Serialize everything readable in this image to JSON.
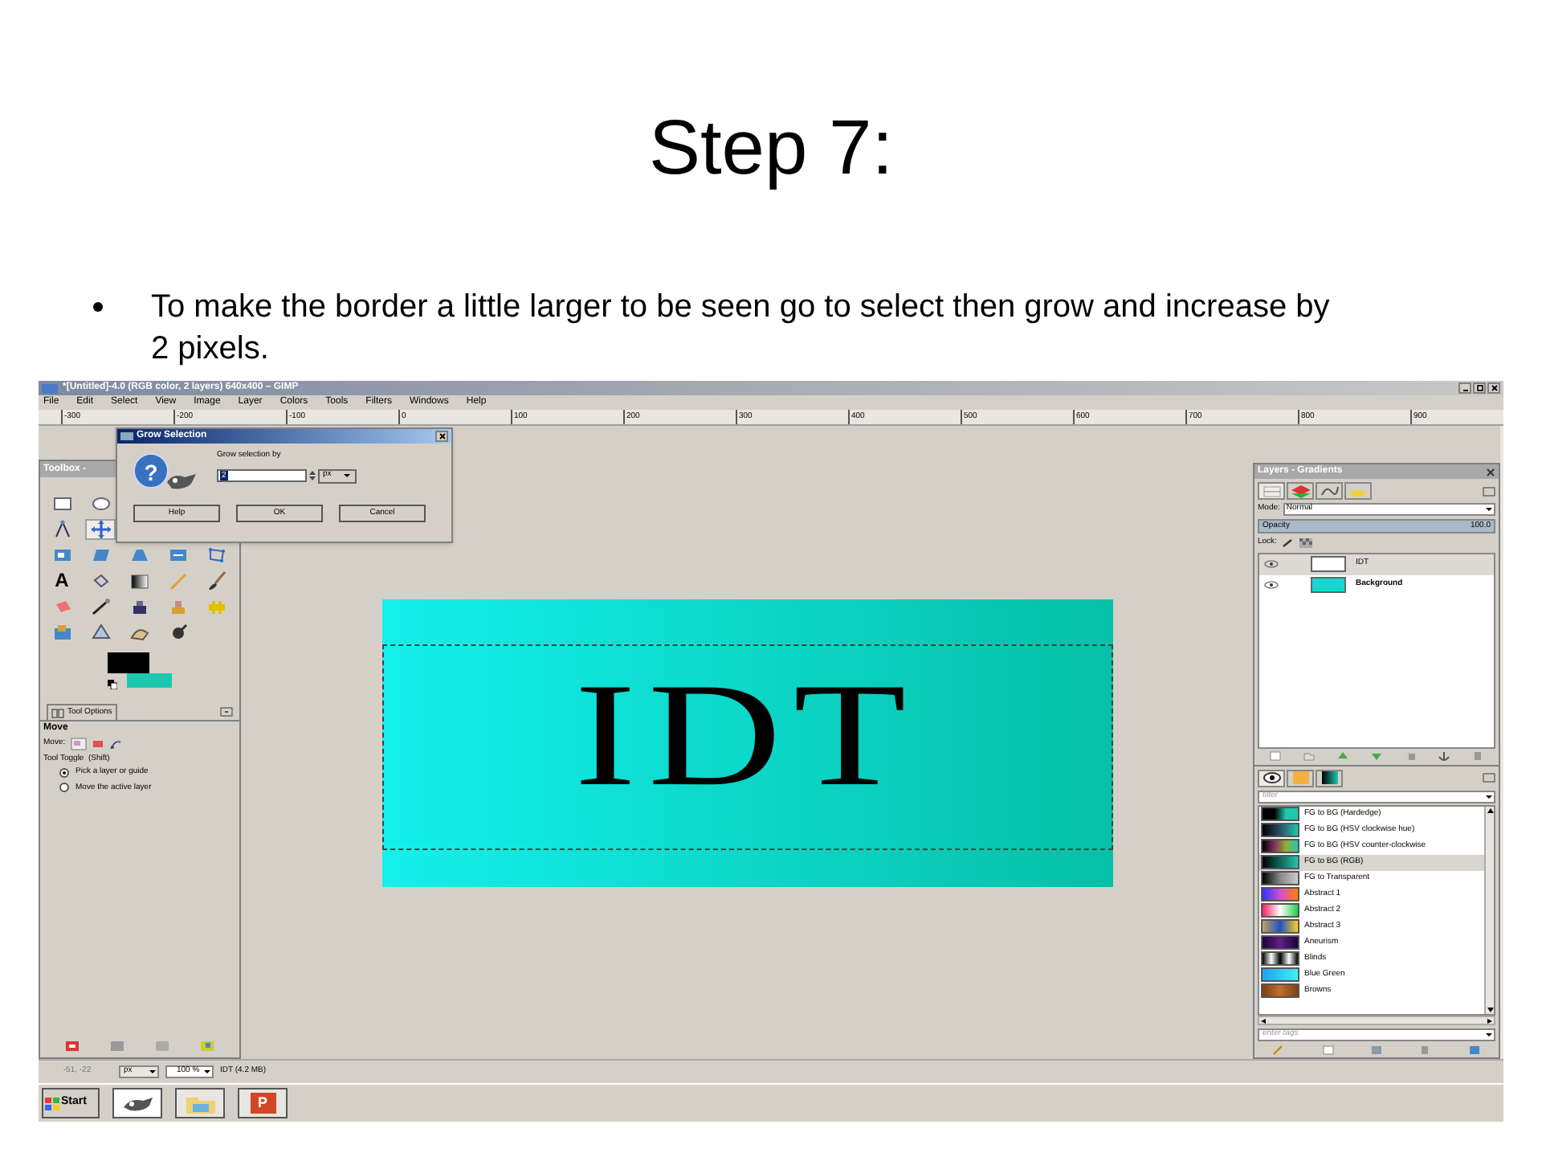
{
  "slide": {
    "title": "Step 7:",
    "bullets": [
      "To make the border a little larger to be seen go to select then grow and increase by 2 pixels."
    ]
  },
  "window": {
    "title": "*[Untitled]-4.0 (RGB color, 2 layers) 640x400 – GIMP",
    "menu": [
      "File",
      "Edit",
      "Select",
      "View",
      "Image",
      "Layer",
      "Colors",
      "Tools",
      "Filters",
      "Windows",
      "Help"
    ],
    "ruler_ticks": [
      "-300",
      "-200",
      "-100",
      "0",
      "100",
      "200",
      "300",
      "400",
      "500",
      "600",
      "700",
      "800",
      "900"
    ]
  },
  "toolbox": {
    "title": "Toolbox - ",
    "text_tool_glyph": "A",
    "options_tab": "Tool Options",
    "tool_name": "Move",
    "move_label": "Move:",
    "toggle_label": "Tool Toggle  (Shift)",
    "radios": [
      {
        "label": "Pick a layer or guide",
        "selected": true
      },
      {
        "label": "Move the active layer",
        "selected": false
      }
    ]
  },
  "canvas": {
    "text": "IDT"
  },
  "dialog": {
    "title": "Grow Selection",
    "icon_glyph": "?",
    "prompt": "Grow selection by",
    "value": "2",
    "unit": "px",
    "buttons": [
      "Help",
      "OK",
      "Cancel"
    ]
  },
  "layers": {
    "title": "Layers - Gradients",
    "mode_label": "Mode:",
    "mode": "Normal",
    "opacity": {
      "label": "Opacity",
      "value": "100.0",
      "level": 1
    },
    "lock_label": "Lock:",
    "items": [
      {
        "name": "IDT",
        "selected": true
      },
      {
        "name": "Background",
        "selected": false
      }
    ]
  },
  "gradients": {
    "filter_placeholder": "filter",
    "tags_placeholder": "enter tags",
    "items": [
      {
        "name": "FG to BG (Hardedge)",
        "selected": false
      },
      {
        "name": "FG to BG (HSV clockwise hue)",
        "selected": false
      },
      {
        "name": "FG to BG (HSV counter-clockwise",
        "selected": false
      },
      {
        "name": "FG to BG (RGB)",
        "selected": true
      },
      {
        "name": "FG to Transparent",
        "selected": false
      },
      {
        "name": "Abstract 1",
        "selected": false
      },
      {
        "name": "Abstract 2",
        "selected": false
      },
      {
        "name": "Abstract 3",
        "selected": false
      },
      {
        "name": "Aneurism",
        "selected": false
      },
      {
        "name": "Blinds",
        "selected": false
      },
      {
        "name": "Blue Green",
        "selected": false
      },
      {
        "name": "Browns",
        "selected": false
      }
    ]
  },
  "status": {
    "coords": "-51, -22",
    "unit": "px",
    "zoom": "100 %",
    "info": "IDT (4.2 MB)"
  },
  "taskbar": {
    "start": "Start",
    "powerpoint_glyph": "P"
  }
}
